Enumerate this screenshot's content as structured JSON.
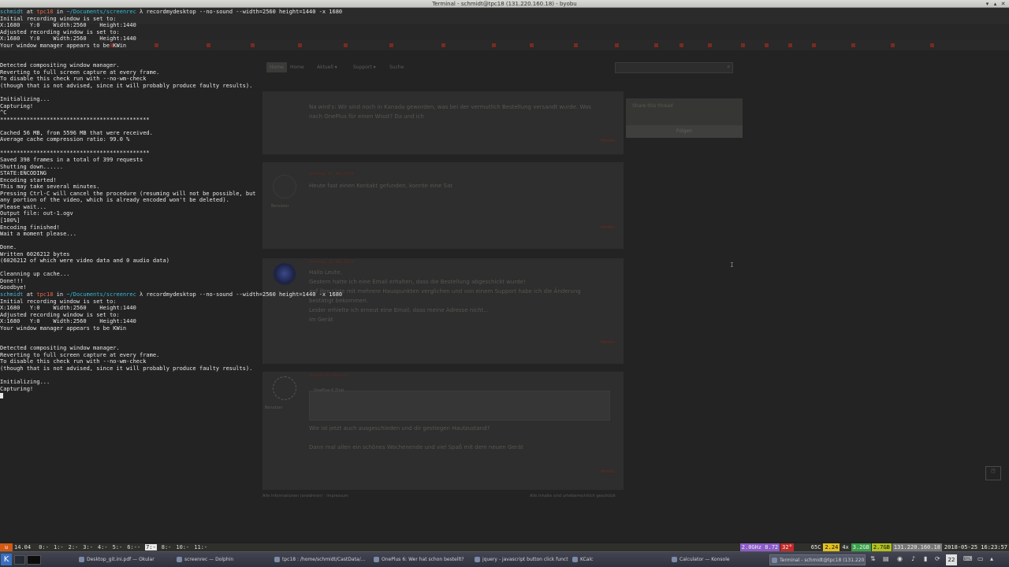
{
  "window": {
    "title": "Terminal - schmidt@tpc18 (131.220.160.18) - byobu",
    "buttons": [
      "▾",
      "▴",
      "✕"
    ]
  },
  "browser": {
    "nav": [
      "Home",
      "Home",
      "Aktuell ▾",
      "Support ▾",
      "Suche"
    ],
    "posts": [
      {
        "text_lines": [
          "Na wird's: Wir sind noch in Kanada geworden, was bei der vermutlich Bestellung versandt wurde. Was",
          "nach OnePlus für einen Wisst? Da und ich"
        ],
        "mark": "Melden"
      },
      {
        "meta": "Sonntag, 20. Mai 2018",
        "text_lines": [
          "Heute fast einen Kontakt gefunden, konnte eine Sat"
        ],
        "mark": "Melden",
        "user": "Benutzer"
      },
      {
        "meta": "Sonntag, 20. Mai 2018",
        "text_lines": [
          "Hallo Leute,",
          "Gestern hatte ich eine Email erhalten, dass die Bestellung abgeschickt wurde!",
          "auf ihre Liste mit mehrere Hauspunkten verglichen und von einem Support habe ich die Änderung",
          "bestätigt bekommen.",
          "Leider erhielte ich erneut eine Email, dass meine Adresse nicht...",
          "im Gerät"
        ],
        "mark": "Melden"
      },
      {
        "meta": "Antwort auf Beitrag",
        "quote": "OnePlus 6 Zitat",
        "text_lines": [
          "Wie ist jetzt auch ausgeschieden und dir gestiegen Hautzustand?",
          "Dann mal allen ein schönes Wochenende und viel Spaß mit dem neuen Gerät"
        ],
        "mark": "Melden",
        "user": "Benutzer"
      }
    ],
    "sidebar": {
      "title": "Share this thread",
      "button": "Folgen"
    },
    "footer_left": "Alle Informationen (erwähnen) · Impressum",
    "footer_right": "Alle Inhalte sind urheberrechtlich geschützt"
  },
  "terminal": {
    "lines": [
      {
        "type": "prompt",
        "user": "schmidt",
        "host": "tpc18",
        "path": "~/Documents/screenrec",
        "cmd": "recordmydesktop --no-sound --width=2560 height=1440 -x 1680"
      },
      {
        "type": "text",
        "text": "Initial recording window is set to:"
      },
      {
        "type": "text",
        "text": "X:1680   Y:0    Width:2560    Height:1440"
      },
      {
        "type": "text",
        "text": "Adjusted recording window is set to:"
      },
      {
        "type": "text",
        "text": "X:1680   Y:0    Width:2560    Height:1440"
      },
      {
        "type": "text",
        "text": "Your window manager appears to be KWin"
      },
      {
        "type": "text",
        "text": ""
      },
      {
        "type": "text",
        "text": ""
      },
      {
        "type": "text",
        "text": "Detected compositing window manager."
      },
      {
        "type": "text",
        "text": "Reverting to full screen capture at every frame."
      },
      {
        "type": "text",
        "text": "To disable this check run with --no-wm-check"
      },
      {
        "type": "text",
        "text": "(though that is not advised, since it will probably produce faulty results)."
      },
      {
        "type": "text",
        "text": ""
      },
      {
        "type": "text",
        "text": "Initializing..."
      },
      {
        "type": "text",
        "text": "Capturing!"
      },
      {
        "type": "text",
        "text": "^C"
      },
      {
        "type": "text",
        "text": "*********************************************"
      },
      {
        "type": "text",
        "text": ""
      },
      {
        "type": "text",
        "text": "Cached 56 MB, from 5596 MB that were received."
      },
      {
        "type": "text",
        "text": "Average cache compression ratio: 99.0 %"
      },
      {
        "type": "text",
        "text": ""
      },
      {
        "type": "text",
        "text": "*********************************************"
      },
      {
        "type": "text",
        "text": "Saved 398 frames in a total of 399 requests"
      },
      {
        "type": "text",
        "text": "Shutting down......"
      },
      {
        "type": "text",
        "text": "STATE:ENCODING"
      },
      {
        "type": "text",
        "text": "Encoding started!"
      },
      {
        "type": "text",
        "text": "This may take several minutes."
      },
      {
        "type": "text",
        "text": "Pressing Ctrl-C will cancel the procedure (resuming will not be possible, but"
      },
      {
        "type": "text",
        "text": "any portion of the video, which is already encoded won't be deleted)."
      },
      {
        "type": "text",
        "text": "Please wait..."
      },
      {
        "type": "text",
        "text": "Output file: out-1.ogv"
      },
      {
        "type": "text",
        "text": "[100%]"
      },
      {
        "type": "text",
        "text": "Encoding finished!"
      },
      {
        "type": "text",
        "text": "Wait a moment please..."
      },
      {
        "type": "text",
        "text": ""
      },
      {
        "type": "text",
        "text": "Done."
      },
      {
        "type": "text",
        "text": "Written 6026212 bytes"
      },
      {
        "type": "text",
        "text": "(6026212 of which were video data and 0 audio data)"
      },
      {
        "type": "text",
        "text": ""
      },
      {
        "type": "text",
        "text": "Cleanning up cache..."
      },
      {
        "type": "text",
        "text": "Done!!!"
      },
      {
        "type": "text",
        "text": "Goodbye!"
      },
      {
        "type": "prompt",
        "user": "schmidt",
        "host": "tpc18",
        "path": "~/Documents/screenrec",
        "cmd": "recordmydesktop --no-sound --width=2560 height=1440 -x 1680"
      },
      {
        "type": "text",
        "text": "Initial recording window is set to:"
      },
      {
        "type": "text",
        "text": "X:1680   Y:0    Width:2560    Height:1440"
      },
      {
        "type": "text",
        "text": "Adjusted recording window is set to:"
      },
      {
        "type": "text",
        "text": "X:1680   Y:0    Width:2560    Height:1440"
      },
      {
        "type": "text",
        "text": "Your window manager appears to be KWin"
      },
      {
        "type": "text",
        "text": ""
      },
      {
        "type": "text",
        "text": ""
      },
      {
        "type": "text",
        "text": "Detected compositing window manager."
      },
      {
        "type": "text",
        "text": "Reverting to full screen capture at every frame."
      },
      {
        "type": "text",
        "text": "To disable this check run with --no-wm-check"
      },
      {
        "type": "text",
        "text": "(though that is not advised, since it will probably produce faulty results)."
      },
      {
        "type": "text",
        "text": ""
      },
      {
        "type": "text",
        "text": "Initializing..."
      },
      {
        "type": "text",
        "text": "Capturing!"
      },
      {
        "type": "cursor"
      }
    ]
  },
  "byobu": {
    "load": "14.04",
    "windows": [
      "0:-",
      "1:-",
      "2:-",
      "3:-",
      "4:-",
      "5:-",
      "6:--",
      "7:-",
      "8:-",
      "10:-",
      "11:-"
    ],
    "active_window": "7:-",
    "stats": [
      {
        "text": "2.0GHz 8.72",
        "color": "#8c5cc8"
      },
      {
        "text": "32°",
        "color": "#c22a2a"
      },
      {
        "text": "",
        "color": "#999"
      },
      {
        "text": "65C",
        "color": "#2f2f2c"
      },
      {
        "text": "2.24",
        "color": "#e0c020"
      },
      {
        "text": "4x",
        "color": "#2f2f2c"
      },
      {
        "text": "3.2GB",
        "color": "#3aa04a"
      },
      {
        "text": "2.7GB",
        "color": "#b0c020"
      },
      {
        "text": "131.220.160.18",
        "color": "#777"
      },
      {
        "text": "2018-05-25 16:23:57",
        "color": "#2f2f2c"
      }
    ]
  },
  "taskbar": {
    "tasks": [
      {
        "label": "Desktop_git.ini.pdf — Okular",
        "active": false
      },
      {
        "label": "screenrec — Dolphin",
        "active": false
      },
      {
        "label": "tpc18 : /home/schmidt/CastData/...",
        "active": false
      },
      {
        "label": "OnePlus 6: Wer hat schon bestellt?",
        "active": false
      },
      {
        "label": "jquery - javascript button click funct",
        "active": false
      },
      {
        "label": "KCalc",
        "active": false
      },
      {
        "label": "Calculator — Konsole",
        "active": false
      },
      {
        "label": "Terminal - schmidt@tpc18 (131.220.16",
        "active": true
      }
    ],
    "day": "22"
  }
}
